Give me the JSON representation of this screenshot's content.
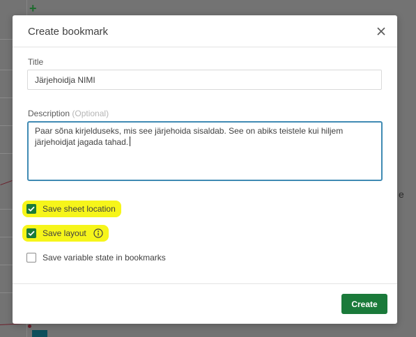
{
  "dialog": {
    "title": "Create bookmark",
    "close_icon": "close-icon"
  },
  "form": {
    "title_label": "Title",
    "title_value": "Järjehoidja NIMI",
    "description_label": "Description",
    "description_optional": "(Optional)",
    "description_value": "Paar sõna kirjelduseks, mis see järjehoida sisaldab. See on abiks teistele kui hiljem järjehoidjat jagada tahad."
  },
  "options": [
    {
      "label": "Save sheet location",
      "checked": true,
      "highlighted": true
    },
    {
      "label": "Save layout",
      "checked": true,
      "highlighted": true,
      "icon": "info-icon"
    },
    {
      "label": "Save variable state in bookmarks",
      "checked": false,
      "highlighted": false
    }
  ],
  "footer": {
    "create_label": "Create"
  },
  "background": {
    "edge_letter": "e",
    "plus_sign": "+"
  },
  "colors": {
    "accent_green": "#1a7a3a",
    "focus_blue": "#3f8ab3",
    "highlight_yellow": "#f6f51a"
  }
}
